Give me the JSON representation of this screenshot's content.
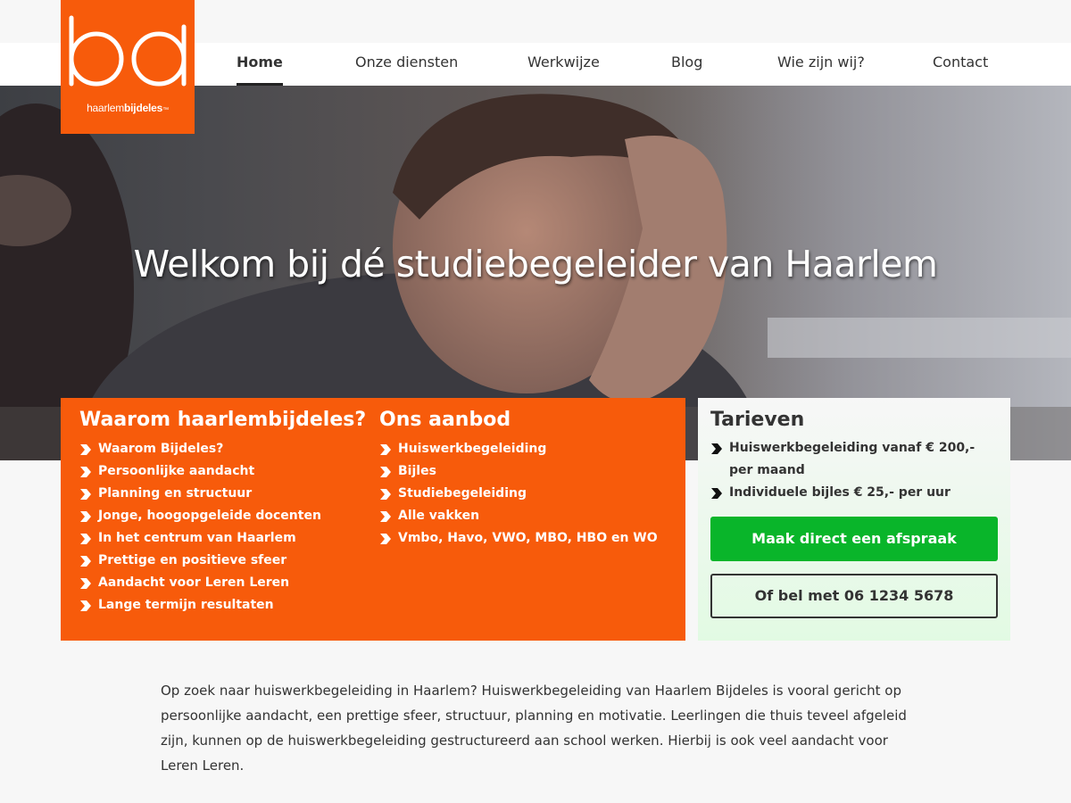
{
  "logo": {
    "letters": "bd",
    "tagline_part1": "haarlem",
    "tagline_part2": "bij",
    "tagline_part3": "deles",
    "tagline_suffix": "™",
    "color": "#f75b0b"
  },
  "nav": {
    "items": [
      {
        "label": "Home",
        "active": true
      },
      {
        "label": "Onze diensten",
        "active": false
      },
      {
        "label": "Werkwijze",
        "active": false
      },
      {
        "label": "Blog",
        "active": false
      },
      {
        "label": "Wie zijn wij?",
        "active": false
      },
      {
        "label": "Contact",
        "active": false
      }
    ]
  },
  "hero": {
    "title": "Welkom bij dé studiebegeleider van Haarlem"
  },
  "why": {
    "heading": "Waarom haarlembijdeles?",
    "items": [
      "Waarom Bijdeles?",
      "Persoonlijke aandacht",
      "Planning en structuur",
      "Jonge, hoogopgeleide docenten",
      "In het centrum van Haarlem",
      "Prettige en positieve sfeer",
      "Aandacht voor Leren Leren",
      "Lange termijn resultaten"
    ]
  },
  "offer": {
    "heading": "Ons aanbod",
    "items": [
      "Huiswerkbegeleiding",
      "Bijles",
      "Studiebegeleiding",
      "Alle vakken",
      "Vmbo, Havo, VWO, MBO, HBO en WO"
    ]
  },
  "rates": {
    "heading": "Tarieven",
    "items": [
      "Huiswerkbegeleiding vanaf € 200,- per maand",
      "Individuele bijles € 25,- per uur"
    ],
    "cta_primary": "Maak direct een afspraak",
    "cta_secondary": "Of bel met 06 1234 5678"
  },
  "intro": {
    "text": "Op zoek naar huiswerkbegeleiding in Haarlem? Huiswerkbegeleiding van Haarlem Bijdeles is vooral gericht op persoonlijke aandacht, een prettige sfeer, structuur, planning en motivatie. Leerlingen die thuis teveel afgeleid zijn, kunnen op de huiswerkbegeleiding gestructureerd aan school werken. Hierbij is ook veel aandacht voor Leren Leren."
  },
  "colors": {
    "brand_orange": "#f75b0b",
    "cta_green": "#09b52a",
    "text_dark": "#333333"
  }
}
